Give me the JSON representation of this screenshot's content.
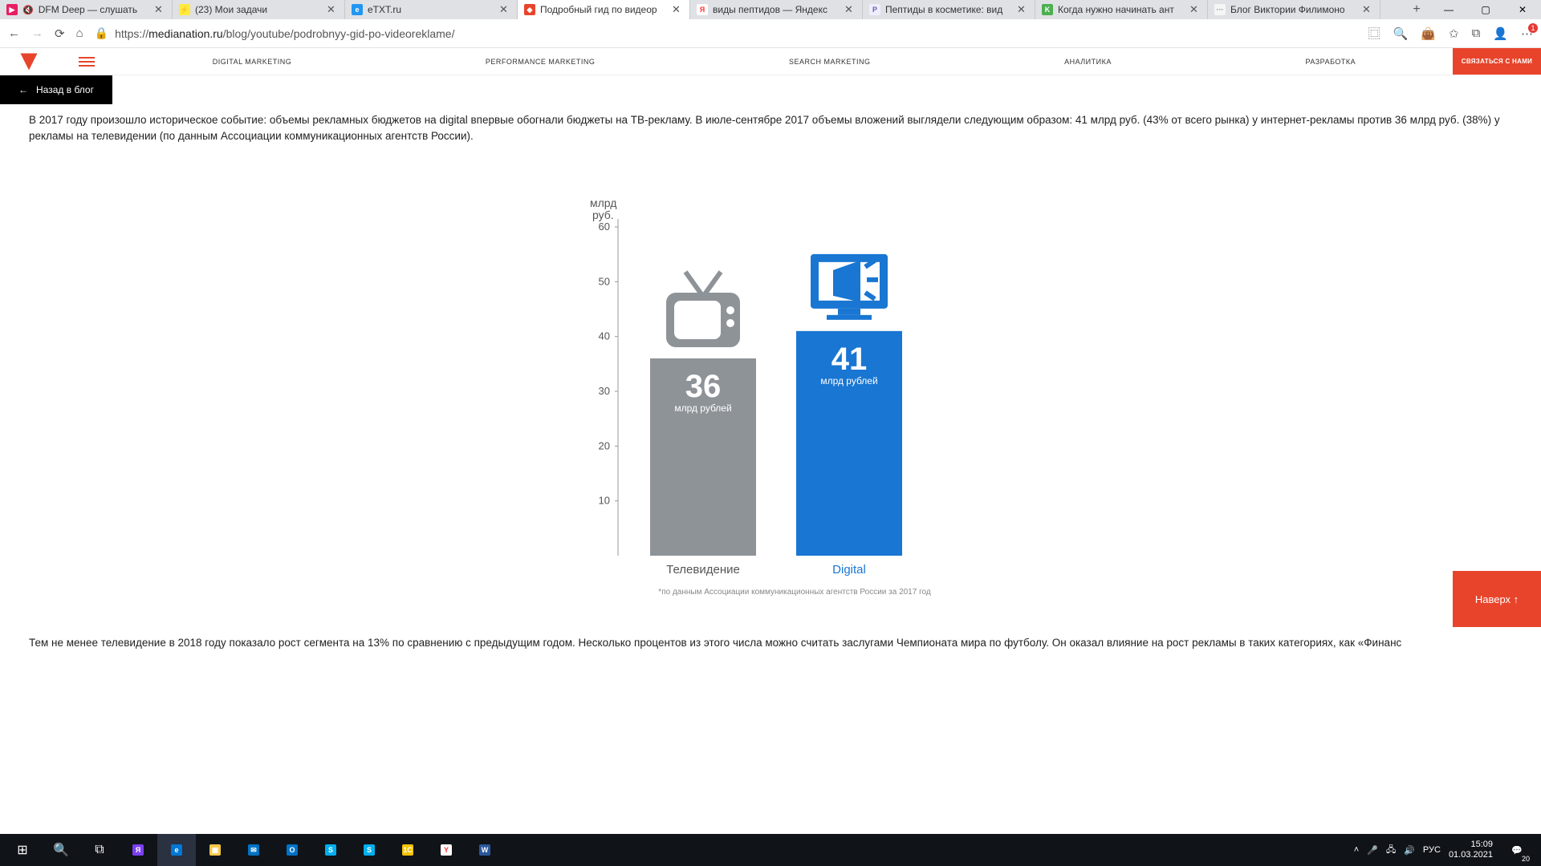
{
  "browser": {
    "tabs": [
      {
        "label": "DFM Deep — слушать",
        "fav_bg": "#e91e63",
        "fav_txt": "▶"
      },
      {
        "label": "(23) Мои задачи",
        "fav_bg": "#ffeb3b",
        "fav_txt": "⚡"
      },
      {
        "label": "eTXT.ru",
        "fav_bg": "#2196f3",
        "fav_txt": "e"
      },
      {
        "label": "Подробный гид по видеор",
        "fav_bg": "#e8442b",
        "fav_txt": "◆",
        "active": true
      },
      {
        "label": "виды пептидов — Яндекс",
        "fav_bg": "#fff",
        "fav_txt": "Я",
        "fav_color": "#f33"
      },
      {
        "label": "Пептиды в косметике: вид",
        "fav_bg": "#eef",
        "fav_txt": "P",
        "fav_color": "#66a"
      },
      {
        "label": "Когда нужно начинать ант",
        "fav_bg": "#4caf50",
        "fav_txt": "K"
      },
      {
        "label": "Блог Виктории Филимоно",
        "fav_bg": "#f5f5f5",
        "fav_txt": "···",
        "fav_color": "#888"
      }
    ],
    "url_host": "medianation.ru",
    "url_path": "/blog/youtube/podrobnyy-gid-po-videoreklame/"
  },
  "window": {
    "min": "—",
    "max": "▢",
    "close": "✕"
  },
  "nav": {
    "back": "←",
    "fwd": "→",
    "reload": "⟳",
    "home": "⌂",
    "lock": "🔒"
  },
  "addr_icons": {
    "reader": "▭",
    "zoom": "⊕",
    "star": "☆",
    "fav": "�星",
    "ext": "⊞",
    "user": "◯",
    "more": "⋯"
  },
  "site": {
    "menu": [
      "DIGITAL MARKETING",
      "PERFORMANCE MARKETING",
      "SEARCH MARKETING",
      "АНАЛИТИКА",
      "РАЗРАБОТКА"
    ],
    "cta": "СВЯЗАТЬСЯ С НАМИ",
    "back_to_blog": "Назад в блог",
    "to_top": "Наверх ↑"
  },
  "article": {
    "p1": "В 2017 году произошло историческое событие: объемы рекламных бюджетов на digital впервые обогнали бюджеты на ТВ-рекламу. В июле-сентябре 2017 объемы вложений выглядели следующим образом: 41 млрд руб. (43% от всего рынка) у интернет-рекламы против 36 млрд руб. (38%) у рекламы на телевидении (по данным Ассоциации коммуникационных агентств России).",
    "p2": "Тем не менее телевидение в 2018 году показало рост сегмента на 13% по сравнению с предыдущим годом. Несколько процентов из этого числа можно считать заслугами Чемпионата мира по футболу. Он оказал влияние на рост рекламы в таких категориях, как «Финанс"
  },
  "chart_data": {
    "type": "bar",
    "ylabel_line1": "млрд",
    "ylabel_line2": "руб.",
    "ylim": [
      0,
      60
    ],
    "yticks": [
      10,
      20,
      30,
      40,
      50,
      60
    ],
    "categories": [
      "Телевидение",
      "Digital"
    ],
    "values": [
      36,
      41
    ],
    "bar_value_labels": [
      "36",
      "41"
    ],
    "bar_sub_labels": [
      "млрд рублей",
      "млрд рублей"
    ],
    "colors": [
      "#8e9398",
      "#1976d2"
    ],
    "footnote": "*по данным Ассоциации коммуникационных агентств России за 2017 год"
  },
  "taskbar": {
    "lang": "РУС",
    "time": "15:09",
    "date": "01.03.2021",
    "notif_count": "20"
  }
}
